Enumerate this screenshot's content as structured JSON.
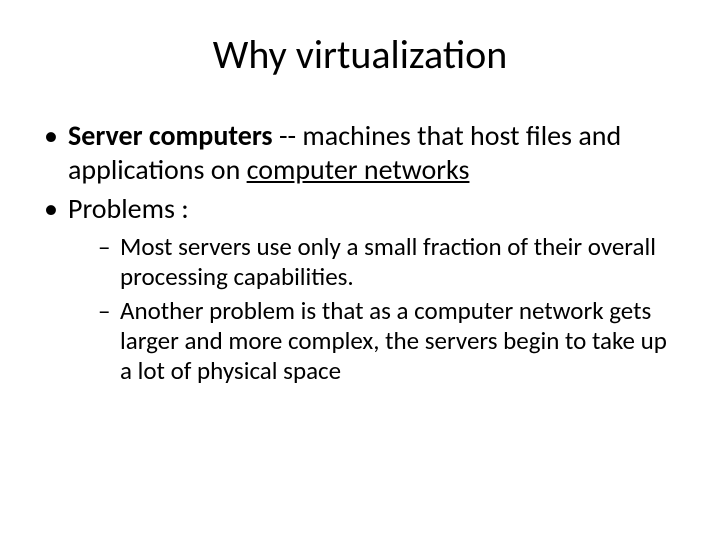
{
  "title": "Why virtualization",
  "bullets": {
    "b1_strong": "Server computers",
    "b1_rest_a": " -- machines that host files and applications on ",
    "b1_link": "computer networks",
    "b2": "Problems :",
    "sub1": "Most servers use only a small fraction of their overall processing capabilities.",
    "sub2": "Another problem is that as a computer network gets larger and more complex, the servers begin to take up a lot of physical space"
  }
}
